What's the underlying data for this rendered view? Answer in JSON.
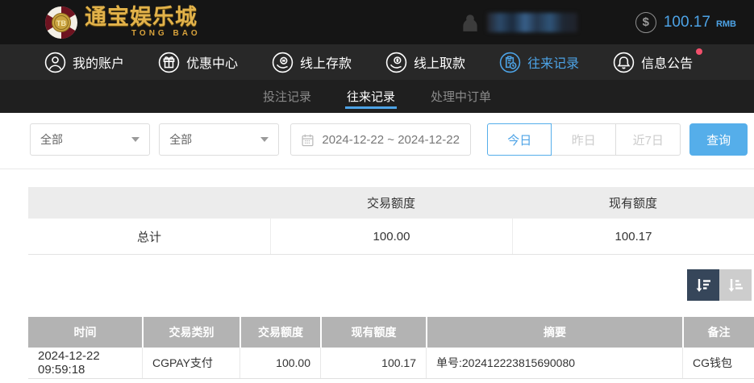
{
  "topbar": {
    "logo": {
      "chip_text": "TB",
      "name_cn": "通宝娱乐城",
      "name_en": "TONG BAO"
    },
    "balance": {
      "currency_icon": "$",
      "amount": "100.17",
      "currency": "RMB"
    }
  },
  "nav": {
    "items": [
      {
        "label": "我的账户",
        "icon": "user-icon",
        "active": false
      },
      {
        "label": "优惠中心",
        "icon": "gift-icon",
        "active": false
      },
      {
        "label": "线上存款",
        "icon": "deposit-icon",
        "active": false
      },
      {
        "label": "线上取款",
        "icon": "withdraw-icon",
        "active": false
      },
      {
        "label": "往来记录",
        "icon": "records-icon",
        "active": true
      },
      {
        "label": "信息公告",
        "icon": "bell-icon",
        "active": false,
        "has_red_dot": true
      }
    ]
  },
  "subtabs": {
    "items": [
      {
        "label": "投注记录",
        "active": false
      },
      {
        "label": "往来记录",
        "active": true
      },
      {
        "label": "处理中订单",
        "active": false
      }
    ]
  },
  "filters": {
    "type_dropdown_1": "全部",
    "type_dropdown_2": "全部",
    "date_range": "2024-12-22 ~ 2024-12-22",
    "quick_buttons": [
      {
        "label": "今日",
        "active": true
      },
      {
        "label": "昨日",
        "active": false
      },
      {
        "label": "近7日",
        "active": false
      }
    ],
    "search_label": "查询"
  },
  "summary_table": {
    "headers": [
      "",
      "交易额度",
      "现有额度"
    ],
    "rows": [
      [
        "总计",
        "100.00",
        "100.17"
      ]
    ]
  },
  "records_table": {
    "headers": [
      "时间",
      "交易类别",
      "交易额度",
      "现有额度",
      "摘要",
      "备注"
    ],
    "rows": [
      [
        "2024-12-22 09:59:18",
        "CGPAY支付",
        "100.00",
        "100.17",
        "单号:202412223815690080",
        "CG钱包"
      ]
    ]
  },
  "colors": {
    "accent_blue": "#4da3e6",
    "button_blue": "#55aeea",
    "topbar_bg": "#151515",
    "navbar_bg": "#282828",
    "subtab_bg": "#1f1f1f",
    "table_header_gray": "#b3b3b3",
    "summary_header_gray": "#ececec",
    "sort_dark": "#36465a",
    "red_dot": "#f2506c",
    "logo_gold": "#e2b24a"
  }
}
